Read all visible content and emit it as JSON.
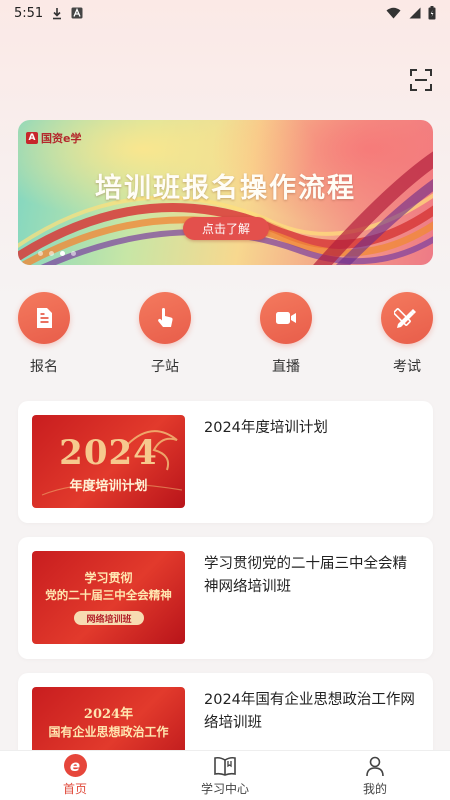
{
  "status_bar": {
    "time": "5:51",
    "left_icons": [
      "download-icon",
      "a-notification-icon"
    ],
    "right_icons": [
      "wifi-icon",
      "signal-icon",
      "battery-icon"
    ]
  },
  "header": {
    "scan_icon": "scan-icon"
  },
  "banner": {
    "logo_text": "国资e学",
    "title": "培训班报名操作流程",
    "button_label": "点击了解",
    "dots_count": 4,
    "active_dot": 3
  },
  "quick_actions": [
    {
      "label": "报名",
      "icon": "form-icon"
    },
    {
      "label": "子站",
      "icon": "tap-icon"
    },
    {
      "label": "直播",
      "icon": "video-camera-icon"
    },
    {
      "label": "考试",
      "icon": "pencil-ruler-icon"
    }
  ],
  "courses": [
    {
      "title": "2024年度培训计划",
      "thumb": {
        "big": "2024",
        "sub": "年度培训计划"
      }
    },
    {
      "title": "学习贯彻党的二十届三中全会精神网络培训班",
      "thumb": {
        "line1": "学习贯彻",
        "line2": "党的二十届三中全会精神",
        "pill": "网络培训班"
      }
    },
    {
      "title": "2024年国有企业思想政治工作网络培训班",
      "thumb": {
        "line1": "2024年",
        "line2": "国有企业思想政治工作"
      }
    }
  ],
  "tabbar": {
    "items": [
      {
        "label": "首页",
        "icon": "home-e-icon",
        "active": true
      },
      {
        "label": "学习中心",
        "icon": "book-icon",
        "active": false
      },
      {
        "label": "我的",
        "icon": "person-icon",
        "active": false
      }
    ],
    "accent": "#e04b3c"
  },
  "colors": {
    "accent": "#e85d4a",
    "card_bg": "#ffffff",
    "page_bg": "#f6f3f3"
  }
}
